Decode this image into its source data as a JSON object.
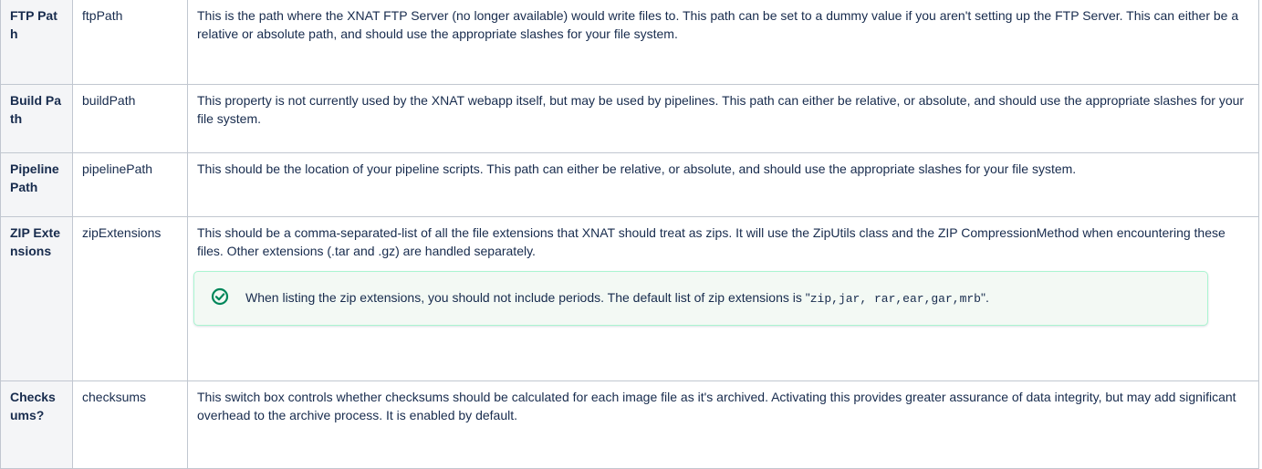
{
  "rows": [
    {
      "name": "FTP Path",
      "key": "ftpPath",
      "desc": "This is the path where the XNAT FTP Server (no longer available) would write files to. This path can be set to a dummy value if you aren't setting up the FTP Server. This can either be a relative or absolute path, and should use the appropriate slashes for your file system."
    },
    {
      "name": "Build Path",
      "key": "buildPath",
      "desc": "This property is not currently used by the XNAT webapp itself, but may be used by pipelines. This path can either be relative, or absolute, and should use the appropriate slashes for your file system."
    },
    {
      "name": "Pipeline Path",
      "key": "pipelinePath",
      "desc": "This should be the location of your pipeline scripts. This path can either be relative, or absolute, and should use the appropriate slashes for your file system."
    },
    {
      "name": "ZIP Extensions",
      "key": "zipExtensions",
      "desc": "This should be a comma-separated-list of all the file extensions that XNAT should treat as zips. It will use the ZipUtils class and the ZIP CompressionMethod when encountering these files. Other extensions (.tar and .gz) are handled separately.",
      "tip": {
        "icon": "check-circle-icon",
        "text_before": "When listing the zip extensions, you should not include periods. The default list of zip extensions is ",
        "open_quote": "\"",
        "code": "zip,jar, rar,ear,gar,mrb",
        "close": "\"."
      }
    },
    {
      "name": "Checksums?",
      "key": "checksums",
      "desc": "This switch box controls whether checksums should be calculated for each image file as it's archived. Activating this provides greater assurance of data integrity, but may add significant overhead to the archive process. It is enabled by default."
    }
  ],
  "colors": {
    "border": "#c1c7d0",
    "header_bg": "#f4f5f7",
    "tip_border": "#abf5d1",
    "tip_bg": "#f3f9f4",
    "tip_icon": "#00875a"
  }
}
